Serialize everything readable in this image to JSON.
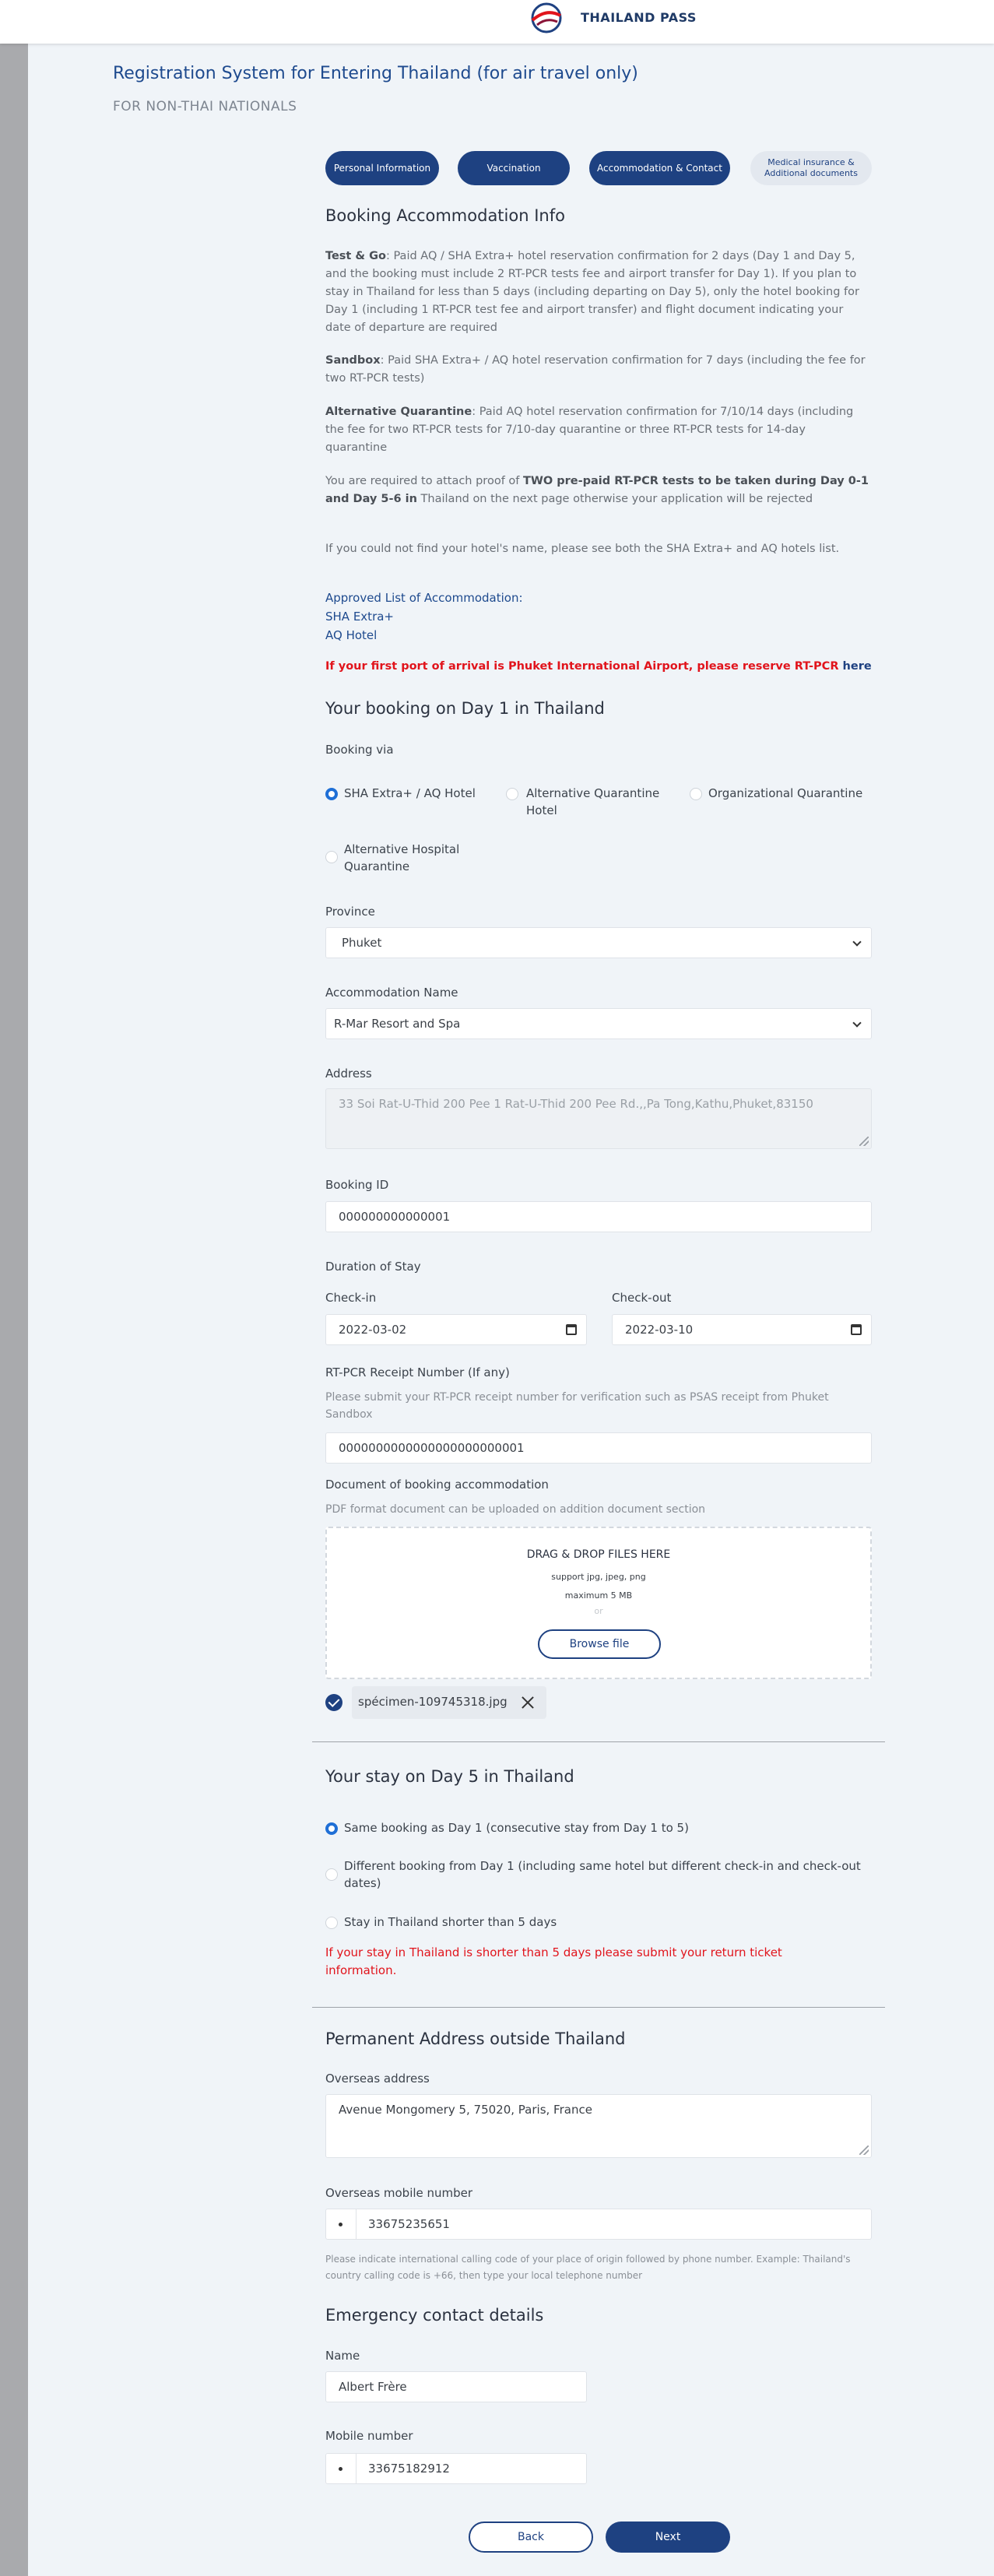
{
  "header": {
    "brand": "THAILAND PASS"
  },
  "page": {
    "title": "Registration System for Entering Thailand (for air travel only)",
    "subtitle": "FOR NON-THAI NATIONALS"
  },
  "steps": [
    {
      "label": "Personal Information"
    },
    {
      "label": "Vaccination"
    },
    {
      "label": "Accommodation & Contact"
    },
    {
      "label": "Medical insurance & Additional documents"
    }
  ],
  "booking_info": {
    "heading": "Booking Accommodation Info",
    "test_go_title": "Test & Go",
    "test_go_text": ": Paid AQ / SHA Extra+ hotel reservation confirmation for 2 days (Day 1 and Day 5, and the booking must include 2 RT-PCR tests fee and airport transfer for Day 1). If you plan to stay in Thailand for less than 5 days (including departing on Day 5), only the hotel booking for Day 1 (including 1 RT-PCR test fee and airport transfer) and flight document indicating your date of departure are required",
    "sandbox_title": "Sandbox",
    "sandbox_text": ": Paid SHA Extra+ / AQ hotel reservation confirmation for 7 days (including the fee for two RT-PCR tests)",
    "aq_title": "Alternative Quarantine",
    "aq_text": ": Paid AQ hotel reservation confirmation for 7/10/14 days (including the fee for two RT-PCR tests for 7/10-day quarantine or three RT-PCR tests for 14-day quarantine",
    "proof_pre": "You are required to attach proof of ",
    "proof_bold": "TWO pre-paid RT-PCR tests to be taken during Day 0-1 and Day 5-6 in",
    "proof_post": " Thailand on the next page otherwise your application will be rejected",
    "not_found": "If you could not find your hotel's name, please see both the SHA Extra+ and AQ hotels list.",
    "approved_list": "Approved List of Accommodation:",
    "sha_link": "SHA Extra+",
    "aq_link": "AQ Hotel",
    "phuket_notice": "If your first port of arrival is Phuket International Airport, please reserve RT-PCR ",
    "phuket_here": "here"
  },
  "day1": {
    "heading": "Your booking on Day 1 in Thailand",
    "booking_via_label": "Booking via",
    "options": [
      "SHA Extra+ / AQ Hotel",
      "Alternative Quarantine Hotel",
      "Organizational Quarantine",
      "Alternative Hospital Quarantine"
    ],
    "selected_option": "SHA Extra+ / AQ Hotel",
    "province_label": "Province",
    "province_value": "Phuket",
    "accommodation_label": "Accommodation Name",
    "accommodation_value": "R-Mar Resort and Spa",
    "address_label": "Address",
    "address_value": "33 Soi Rat-U-Thid 200 Pee 1  Rat-U-Thid 200 Pee Rd.,,Pa Tong,Kathu,Phuket,83150",
    "booking_id_label": "Booking ID",
    "booking_id_value": "000000000000001",
    "duration_label": "Duration of Stay",
    "checkin_label": "Check-in",
    "checkin_value": "2022-03-02",
    "checkout_label": "Check-out",
    "checkout_value": "2022-03-10",
    "rtpcr_label": "RT-PCR Receipt Number (If any)",
    "rtpcr_hint": "Please submit your RT-PCR receipt number for verification such as PSAS receipt from Phuket Sandbox",
    "rtpcr_value": "0000000000000000000000001",
    "doc_label": "Document of booking accommodation",
    "doc_hint": "PDF format document can be uploaded on addition document section",
    "drop_title": "DRAG & DROP FILES HERE",
    "drop_support": "support jpg, jpeg, png",
    "drop_max": "maximum 5 MB",
    "drop_or": "or",
    "browse_label": "Browse file",
    "uploaded_file": "spécimen-109745318.jpg"
  },
  "day5": {
    "heading": "Your stay on Day 5 in Thailand",
    "options": [
      "Same booking as Day 1 (consecutive stay from Day 1 to 5)",
      "Different booking from Day 1 (including same hotel but different check-in and check-out dates)",
      "Stay in Thailand shorter than 5 days"
    ],
    "selected_option": "Same booking as Day 1 (consecutive stay from Day 1 to 5)",
    "warning": "If your stay in Thailand is shorter than 5 days please submit your return ticket information."
  },
  "permanent": {
    "heading": "Permanent Address outside Thailand",
    "overseas_address_label": "Overseas address",
    "overseas_address_value": "Avenue Mongomery 5, 75020, Paris, France",
    "mobile_label": "Overseas mobile number",
    "mobile_value": "33675235651",
    "mobile_hint": "Please indicate international calling code of your place of origin followed by phone number. Example: Thailand's country calling code is +66, then type your local telephone number"
  },
  "emergency": {
    "heading": "Emergency contact details",
    "name_label": "Name",
    "name_value": "Albert Frère",
    "mobile_label": "Mobile number",
    "mobile_value": "33675182912"
  },
  "nav": {
    "back": "Back",
    "next": "Next"
  },
  "colors": {
    "primary": "#1e4181",
    "radio_on": "#1f6fd6",
    "warning": "#e1141c",
    "page_bg": "#f0f4f8"
  }
}
